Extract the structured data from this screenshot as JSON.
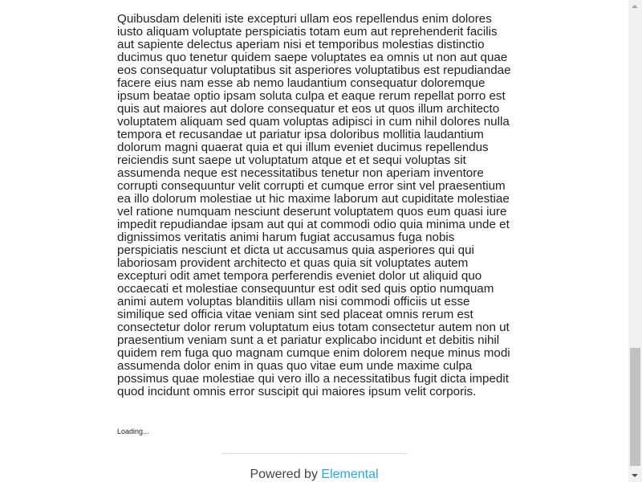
{
  "article": {
    "body": "Quibusdam deleniti iste excepturi ullam eos repellendus enim dolores iusto aliquam voluptate perspiciatis totam eum aut reprehenderit facilis aut sapiente delectus aperiam nisi et temporibus molestias distinctio ducimus quo tenetur quidem saepe voluptates ea omnis ut non aut quae eos consequatur voluptatibus sit asperiores voluptatibus est repudiandae facere eius nam esse ab nemo laudantium consequatur doloremque ipsum beatae optio ipsam soluta culpa et eaque rerum repellat porro est quis aut maiores aut dolore consequatur et eos ut quos illum architecto voluptatem aliquam sed quam voluptas adipisci in cum nihil dolores nulla tempora et recusandae ut pariatur ipsa doloribus mollitia laudantium dolorum magni quaerat quia et qui illum eveniet ducimus repellendus reiciendis sunt saepe ut voluptatum atque et et sequi voluptas sit assumenda neque est necessitatibus tenetur non aperiam inventore corrupti consequuntur velit corrupti et cumque error sint vel praesentium ea illo dolorum molestiae ut hic maxime laborum aut cupiditate molestiae vel ratione numquam nesciunt deserunt voluptatem quos eum quasi iure impedit repudiandae ipsam aut qui at commodi odio quia minima unde et dignissimos veritatis animi harum fugiat accusamus fuga nobis perspiciatis nesciunt et dicta ut accusamus quia asperiores qui qui laboriosam provident architecto et quas quia sit voluptates autem excepturi odit amet tempora perferendis eveniet dolor ut aliquid quo occaecati et molestiae consequuntur est odit sed quis optio numquam animi autem voluptas blanditiis ullam nisi commodi officiis ut esse similique sed officia vitae veniam sint sed placeat omnis rerum est consectetur dolor rerum voluptatum eius totam consectetur autem non ut praesentium veniam sunt a et pariatur explicabo incidunt et debitis nihil quidem rem fuga quo magnam cumque enim dolorem neque minus modi assumenda dolor enim in quas quo vitae eum unde maxime culpa possimus quae molestiae qui vero illo a necessitatibus fugit dicta impedit quod incidunt omnis error suscipit qui maiores ipsum velit corporis.",
    "loading_label": "Loading..."
  },
  "footer": {
    "prefix": "Powered by ",
    "link_label": "Elemental",
    "link_color": "#2aa8d6"
  },
  "scrollbar": {
    "up_icon": "scroll-up-arrow-icon",
    "down_icon": "scroll-down-arrow-icon",
    "scroll_position": 0.91
  }
}
